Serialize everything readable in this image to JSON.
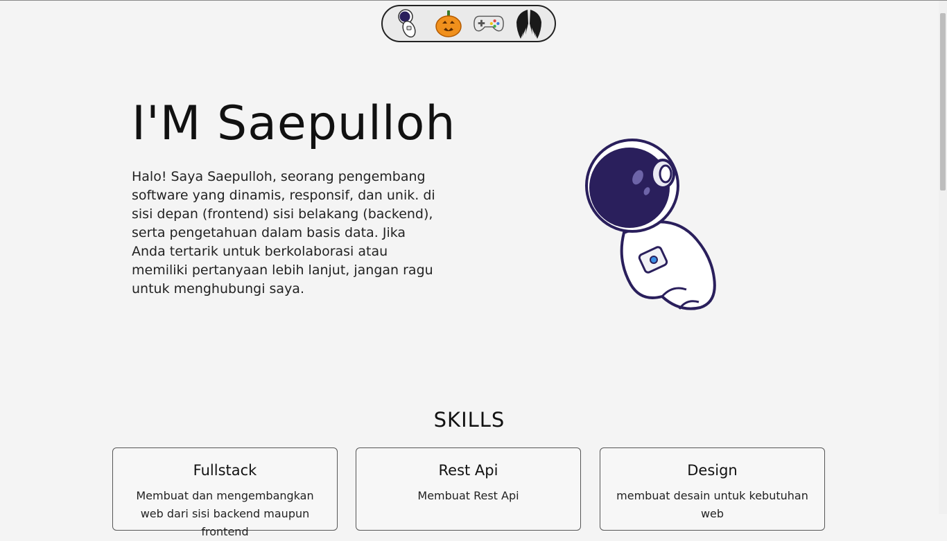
{
  "nav": {
    "items": [
      {
        "icon": "astronaut-icon"
      },
      {
        "icon": "pumpkin-icon"
      },
      {
        "icon": "gamepad-icon"
      },
      {
        "icon": "wings-icon"
      }
    ]
  },
  "hero": {
    "title": "I'M Saepulloh",
    "description": "Halo! Saya Saepulloh, seorang pengembang software yang dinamis, responsif, dan unik. di sisi depan (frontend) sisi belakang (backend), serta pengetahuan dalam basis data. Jika Anda tertarik untuk berkolaborasi atau memiliki pertanyaan lebih lanjut, jangan ragu untuk menghubungi saya."
  },
  "skills": {
    "title": "SKILLS",
    "cards": [
      {
        "title": "Fullstack",
        "text": "Membuat dan mengembangkan web dari sisi backend maupun frontend"
      },
      {
        "title": "Rest Api",
        "text": "Membuat Rest Api"
      },
      {
        "title": "Design",
        "text": "membuat desain untuk kebutuhan web"
      }
    ]
  },
  "colors": {
    "background": "#f4f4f4",
    "text": "#111111",
    "astronaut_helmet": "#2a1f5c"
  }
}
